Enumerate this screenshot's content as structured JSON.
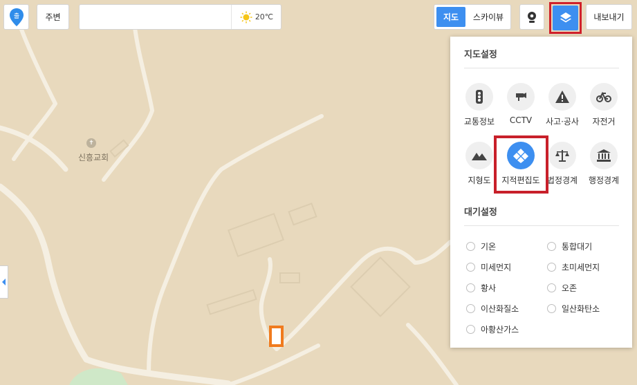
{
  "toolbar": {
    "start_pin_label": "출",
    "around_label": "주변",
    "search_placeholder": "",
    "weather_temp": "20℃",
    "map_type_active": "지도",
    "map_type_skyview": "스카이뷰",
    "export_label": "내보내기"
  },
  "map": {
    "poi_label": "신흥교회"
  },
  "panel": {
    "map_settings_title": "지도설정",
    "tools": [
      {
        "label": "교통정보",
        "icon": "traffic-light-icon"
      },
      {
        "label": "CCTV",
        "icon": "cctv-icon"
      },
      {
        "label": "사고·공사",
        "icon": "warning-icon"
      },
      {
        "label": "자전거",
        "icon": "bicycle-icon"
      },
      {
        "label": "지형도",
        "icon": "mountain-icon"
      },
      {
        "label": "지적편집도",
        "icon": "cadastral-icon"
      },
      {
        "label": "법정경계",
        "icon": "scale-icon"
      },
      {
        "label": "행정경계",
        "icon": "government-icon"
      }
    ],
    "air_settings_title": "대기설정",
    "air_options": [
      "기온",
      "통합대기",
      "미세먼지",
      "초미세먼지",
      "황사",
      "오존",
      "이산화질소",
      "일산화탄소",
      "아황산가스"
    ]
  },
  "colors": {
    "accent": "#3d8ff0",
    "highlight_red": "#c8202a",
    "marker_orange": "#f07b1e",
    "map_bg": "#e8d9bd"
  }
}
